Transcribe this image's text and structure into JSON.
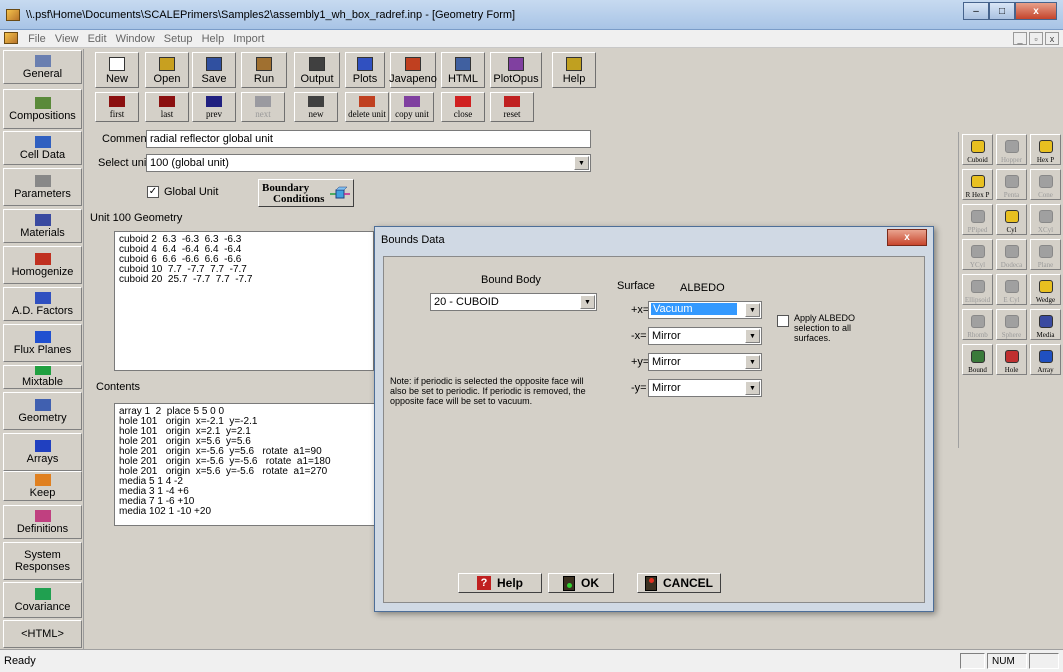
{
  "window": {
    "title": "\\\\.psf\\Home\\Documents\\SCALEPrimers\\Samples2\\assembly1_wh_box_radref.inp - [Geometry Form]",
    "min": "–",
    "max": "□",
    "close": "x"
  },
  "menu": [
    "File",
    "View",
    "Edit",
    "Window",
    "Setup",
    "Help",
    "Import"
  ],
  "mdi": {
    "min": "_",
    "restore": "▫",
    "close": "x"
  },
  "nav": [
    {
      "id": "general",
      "label": "General",
      "icon": "#6a7fb0"
    },
    {
      "id": "compositions",
      "label": "Compositions",
      "icon": "#5a8a3a"
    },
    {
      "id": "cell-data",
      "label": "Cell Data",
      "icon": "#3060c0"
    },
    {
      "id": "parameters",
      "label": "Parameters",
      "icon": "#888888"
    },
    {
      "id": "materials",
      "label": "Materials",
      "icon": "#3a4aa0"
    },
    {
      "id": "homogenize",
      "label": "Homogenize",
      "icon": "#c03020"
    },
    {
      "id": "ad-factors",
      "label": "A.D. Factors",
      "icon": "#3050c0"
    },
    {
      "id": "flux-planes",
      "label": "Flux Planes",
      "icon": "#2050d0"
    },
    {
      "id": "mixtable",
      "label": "Mixtable",
      "icon": "#20a040"
    },
    {
      "id": "geometry",
      "label": "Geometry",
      "icon": "#4060b0"
    },
    {
      "id": "arrays",
      "label": "Arrays",
      "icon": "#2040c0"
    },
    {
      "id": "keep",
      "label": "Keep",
      "icon": "#e08020"
    },
    {
      "id": "definitions",
      "label": "Definitions",
      "icon": "#c04080"
    },
    {
      "id": "system-responses",
      "label": "System Responses",
      "icon": ""
    },
    {
      "id": "covariance",
      "label": "Covariance",
      "icon": "#20a050"
    },
    {
      "id": "html",
      "label": "<HTML>",
      "icon": ""
    }
  ],
  "toolbar": {
    "row1": [
      {
        "id": "new",
        "label": "New"
      },
      {
        "id": "open",
        "label": "Open"
      },
      {
        "id": "save",
        "label": "Save"
      },
      {
        "id": "run",
        "label": "Run"
      },
      {
        "id": "output",
        "label": "Output"
      },
      {
        "id": "plots",
        "label": "Plots"
      },
      {
        "id": "javapeno",
        "label": "Javapeno"
      },
      {
        "id": "html",
        "label": "HTML"
      },
      {
        "id": "plotopus",
        "label": "PlotOpus"
      },
      {
        "id": "help",
        "label": "Help"
      }
    ],
    "row2": [
      {
        "id": "first",
        "label": "first"
      },
      {
        "id": "last",
        "label": "last"
      },
      {
        "id": "prev",
        "label": "prev"
      },
      {
        "id": "next",
        "label": "next"
      },
      {
        "id": "new-unit",
        "label": "new"
      },
      {
        "id": "delete-unit",
        "label": "delete unit"
      },
      {
        "id": "copy-unit",
        "label": "copy unit"
      },
      {
        "id": "close",
        "label": "close"
      },
      {
        "id": "reset",
        "label": "reset"
      }
    ]
  },
  "form": {
    "comment_label": "Comment",
    "comment_value": "radial reflector global unit",
    "select_unit_label": "Select unit",
    "select_unit_value": "100  (global unit)",
    "global_unit_label": "Global Unit",
    "global_unit_checked": "✓",
    "boundary_label_1": "Boundary",
    "boundary_label_2": "Conditions",
    "geometry_label": "Unit 100 Geometry",
    "geometry_text": "cuboid 2  6.3  -6.3  6.3  -6.3\ncuboid 4  6.4  -6.4  6.4  -6.4\ncuboid 6  6.6  -6.6  6.6  -6.6\ncuboid 10  7.7  -7.7  7.7  -7.7\ncuboid 20  25.7  -7.7  7.7  -7.7",
    "contents_label": "Contents",
    "contents_text": "array 1  2  place 5 5 0 0\nhole 101   origin  x=-2.1  y=-2.1\nhole 101   origin  x=2.1  y=2.1\nhole 201   origin  x=5.6  y=5.6\nhole 201   origin  x=-5.6  y=5.6   rotate  a1=90\nhole 201   origin  x=-5.6  y=-5.6   rotate  a1=180\nhole 201   origin  x=5.6  y=-5.6   rotate  a1=270\nmedia 5 1 4 -2\nmedia 3 1 -4 +6\nmedia 7 1 -6 +10\nmedia 102 1 -10 +20"
  },
  "shapes": [
    {
      "id": "cuboid",
      "label": "Cuboid",
      "enabled": true,
      "color": "#e8c020"
    },
    {
      "id": "hopper",
      "label": "Hopper",
      "enabled": false,
      "color": "#a0a0a0"
    },
    {
      "id": "hexp",
      "label": "Hex P",
      "enabled": true,
      "color": "#e8c020"
    },
    {
      "id": "rhexp",
      "label": "R Hex P",
      "enabled": true,
      "color": "#e8c020"
    },
    {
      "id": "penta",
      "label": "Penta",
      "enabled": false,
      "color": "#a0a0a0"
    },
    {
      "id": "cone",
      "label": "Cone",
      "enabled": false,
      "color": "#a0a0a0"
    },
    {
      "id": "ppiped",
      "label": "PPiped",
      "enabled": false,
      "color": "#a0a0a0"
    },
    {
      "id": "cyl",
      "label": "Cyl",
      "enabled": true,
      "color": "#e8c020"
    },
    {
      "id": "xcyl",
      "label": "XCyl",
      "enabled": false,
      "color": "#a0a0a0"
    },
    {
      "id": "ycyl",
      "label": "YCyl",
      "enabled": false,
      "color": "#a0a0a0"
    },
    {
      "id": "dodeca",
      "label": "Dodeca",
      "enabled": false,
      "color": "#a0a0a0"
    },
    {
      "id": "plane",
      "label": "Plane",
      "enabled": false,
      "color": "#a0a0a0"
    },
    {
      "id": "ellipsoid",
      "label": "Ellipsoid",
      "enabled": false,
      "color": "#a0a0a0"
    },
    {
      "id": "ecyl",
      "label": "E Cyl",
      "enabled": false,
      "color": "#a0a0a0"
    },
    {
      "id": "wedge",
      "label": "Wedge",
      "enabled": true,
      "color": "#e8c020"
    },
    {
      "id": "rhomb",
      "label": "Rhomb",
      "enabled": false,
      "color": "#a0a0a0"
    },
    {
      "id": "sphere",
      "label": "Sphere",
      "enabled": false,
      "color": "#a0a0a0"
    },
    {
      "id": "media",
      "label": "Media",
      "enabled": true,
      "color": "#3a4aa0"
    },
    {
      "id": "bound",
      "label": "Bound",
      "enabled": true,
      "color": "#3a7a3a"
    },
    {
      "id": "hole",
      "label": "Hole",
      "enabled": true,
      "color": "#c03030"
    },
    {
      "id": "array",
      "label": "Array",
      "enabled": true,
      "color": "#2050c0"
    }
  ],
  "dialog": {
    "title": "Bounds Data",
    "close": "x",
    "bound_body_label": "Bound Body",
    "bound_body_value": "20 - CUBOID",
    "surface_label": "Surface",
    "albedo_label": "ALBEDO",
    "rows": [
      {
        "face": "+x=",
        "value": "Vacuum",
        "selected": true
      },
      {
        "face": "-x=",
        "value": "Mirror",
        "selected": false
      },
      {
        "face": "+y=",
        "value": "Mirror",
        "selected": false
      },
      {
        "face": "-y=",
        "value": "Mirror",
        "selected": false
      }
    ],
    "apply_all": "Apply ALBEDO selection to all surfaces.",
    "note": "Note: if periodic is selected the opposite face will also be set to periodic.  If periodic is removed, the opposite face will be set to vacuum.",
    "help_label": "Help",
    "ok_label": "OK",
    "cancel_label": "CANCEL"
  },
  "status": {
    "text": "Ready",
    "num": "NUM"
  }
}
